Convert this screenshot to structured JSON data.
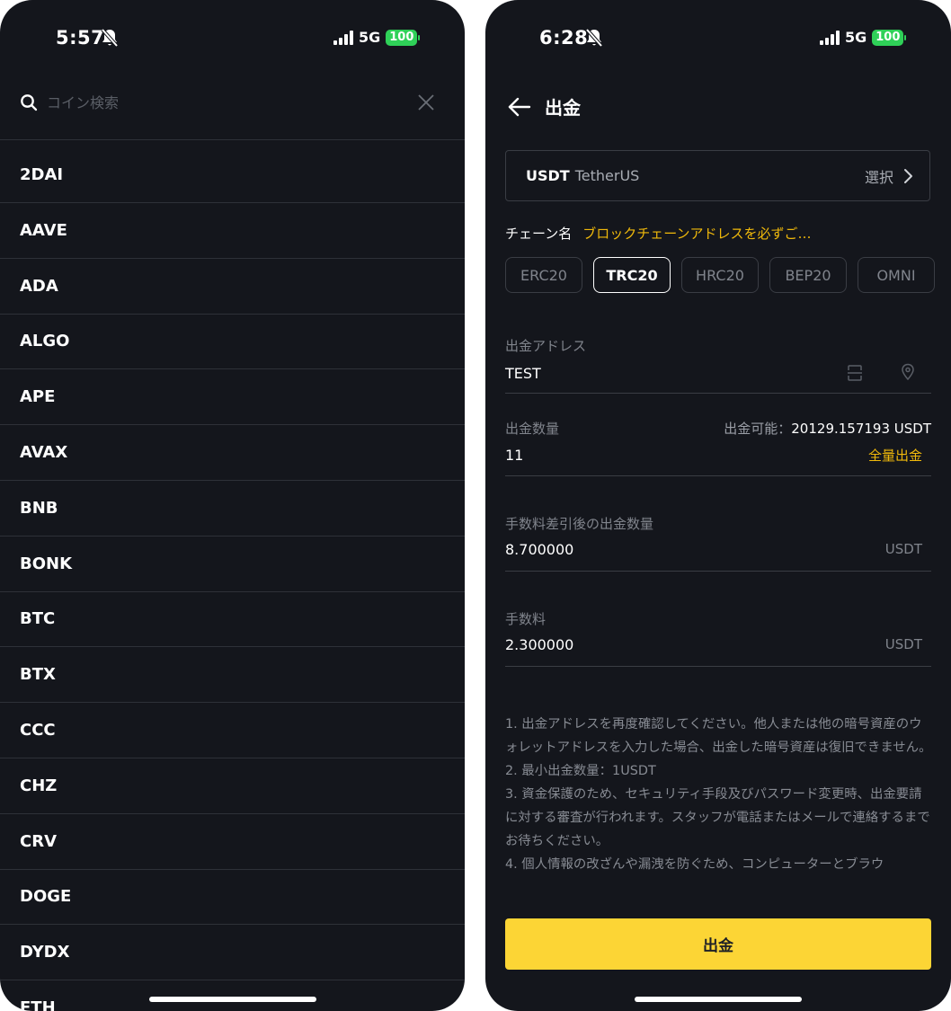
{
  "left_screen": {
    "status": {
      "time": "5:57",
      "network": "5G",
      "battery": "100"
    },
    "search": {
      "placeholder": "コイン検索"
    },
    "coins": [
      "2DAI",
      "AAVE",
      "ADA",
      "ALGO",
      "APE",
      "AVAX",
      "BNB",
      "BONK",
      "BTC",
      "BTX",
      "CCC",
      "CHZ",
      "CRV",
      "DOGE",
      "DYDX",
      "ETH"
    ]
  },
  "right_screen": {
    "status": {
      "time": "6:28",
      "network": "5G",
      "battery": "100"
    },
    "title": "出金",
    "coin": {
      "symbol": "USDT",
      "name": "TetherUS",
      "select_label": "選択"
    },
    "chain": {
      "label": "チェーン名",
      "warning": "ブロックチェーンアドレスを必ずご…",
      "options": [
        "ERC20",
        "TRC20",
        "HRC20",
        "BEP20",
        "OMNI"
      ],
      "selected": "TRC20"
    },
    "address": {
      "label": "出金アドレス",
      "value": "TEST"
    },
    "amount": {
      "label": "出金数量",
      "available_label": "出金可能：",
      "available_value": "20129.157193 USDT",
      "value": "11",
      "max_label": "全量出金"
    },
    "net_amount": {
      "label": "手数料差引後の出金数量",
      "value": "8.700000",
      "unit": "USDT"
    },
    "fee": {
      "label": "手数料",
      "value": "2.300000",
      "unit": "USDT"
    },
    "notes": [
      "1. 出金アドレスを再度確認してください。他人または他の暗号資産のウォレットアドレスを入力した場合、出金した暗号資産は復旧できません。",
      "2. 最小出金数量：1USDT",
      "3. 資金保護のため、セキュリティ手段及びパスワード変更時、出金要請に対する審査が行われます。スタッフが電話またはメールで連絡するまでお待ちください。",
      "4. 個人情報の改ざんや漏洩を防ぐため、コンピューターとブラウ"
    ],
    "submit_label": "出金"
  }
}
